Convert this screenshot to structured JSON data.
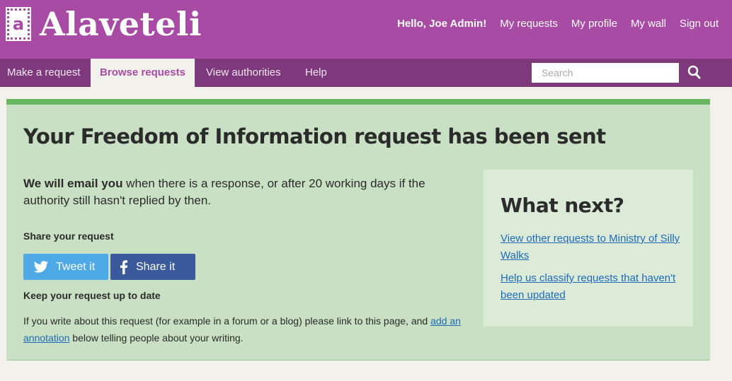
{
  "header": {
    "logo_badge": "a",
    "logo_text": "Alaveteli",
    "links": [
      "Hello, Joe Admin!",
      "My requests",
      "My profile",
      "My wall",
      "Sign out"
    ]
  },
  "nav": {
    "items": [
      "Make a request",
      "Browse requests",
      "View authorities",
      "Help"
    ],
    "active": "Browse requests",
    "search_placeholder": "Search"
  },
  "main": {
    "title": "Your Freedom of Information request has been sent",
    "lead_bold": "We will email you",
    "lead_rest": " when there is a response, or after 20 working days if the authority still hasn't replied by then.",
    "share_heading": "Share your request",
    "tweet_label": "Tweet it",
    "share_label": "Share it",
    "keep_heading": "Keep your request up to date",
    "keep_text_before": "If you write about this request (for example in a forum or a blog) please link to this page, and ",
    "annotation_link": "add an annotation",
    "keep_text_after": " below telling people about your writing."
  },
  "sidebar": {
    "title": "What next?",
    "link1": "View other requests to Ministry of Silly Walks",
    "link2": "Help us classify requests that haven't been updated"
  },
  "colors": {
    "brand": "#a84ba5",
    "nav": "#7d397b",
    "success_panel": "#c9e0c4",
    "success_border": "#6ab55f",
    "twitter": "#4ea9e6",
    "facebook": "#3a5a9b",
    "link": "#1e6ab8"
  },
  "icons": [
    "logo-icon",
    "search-icon",
    "twitter-icon",
    "facebook-icon"
  ]
}
